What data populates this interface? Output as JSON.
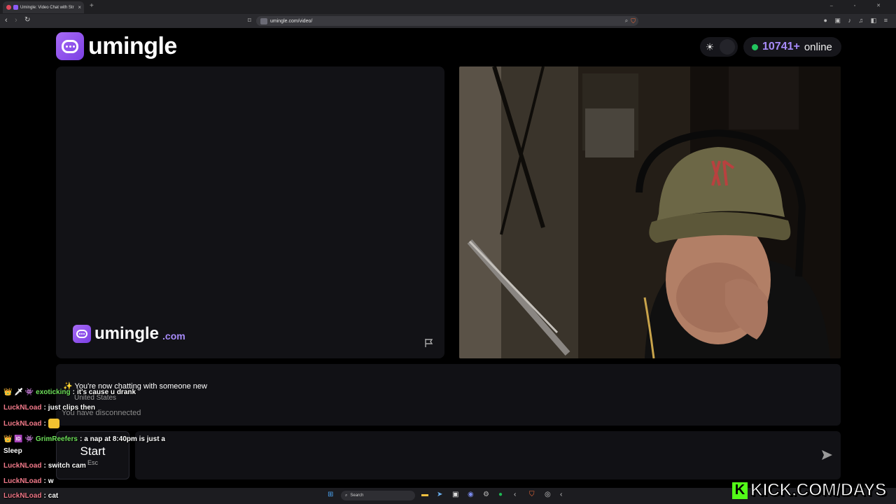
{
  "browser": {
    "tab_title": "Umingle: Video Chat with Str",
    "tab_close": "×",
    "new_tab": "+",
    "url": "umingle.com/video/",
    "window_controls": "‒ ▫ ✕"
  },
  "header": {
    "logo_text": "umingle",
    "online_count": "10741+",
    "online_label": "online"
  },
  "video": {
    "watermark_name": "umingle",
    "watermark_tld": ".com"
  },
  "status": {
    "new_chat": "✨ You're now chatting with someone new",
    "country": "United States",
    "disconnected": "You have disconnected"
  },
  "controls": {
    "start_label": "Start",
    "start_hint": "Esc",
    "message_placeholder": ""
  },
  "chat_overlay": [
    {
      "badges": "👑 🗡 👾",
      "user": "exoticking",
      "message": "it's cause u drank"
    },
    {
      "badges": "",
      "user": "LuckNLoad",
      "message": "just clips then"
    },
    {
      "badges": "",
      "user": "LuckNLoad",
      "message": ""
    },
    {
      "badges": "👑 🆔 👾",
      "user": "GrimReefers",
      "message": "a nap at 8:40pm is just a"
    },
    {
      "badges": "",
      "user": "",
      "message": "Sleep"
    },
    {
      "badges": "",
      "user": "LuckNLoad",
      "message": "switch cam"
    },
    {
      "badges": "",
      "user": "LuckNLoad",
      "message": "w"
    },
    {
      "badges": "",
      "user": "LuckNLoad",
      "message": "cat"
    }
  ],
  "taskbar": {
    "search_label": "Search"
  },
  "stream_overlay": {
    "kick_letter": "K",
    "kick_text": "KICK.COM/DAYS"
  },
  "colors": {
    "accent": "#8b5cf6",
    "online_green": "#22c55e",
    "kick_green": "#53fc18"
  }
}
